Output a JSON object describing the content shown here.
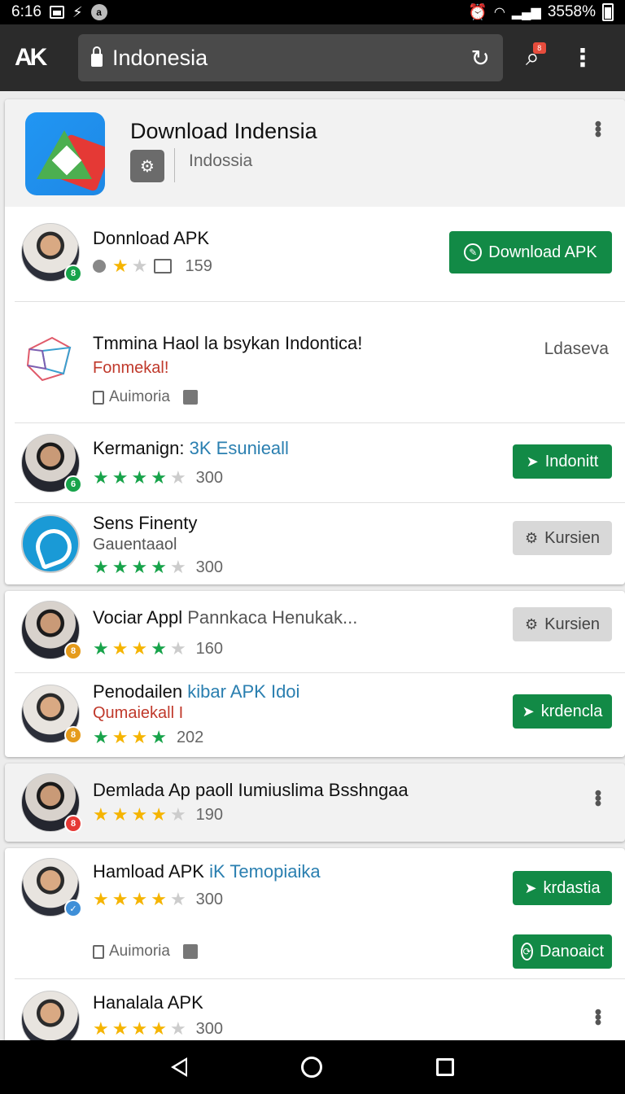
{
  "status_bar": {
    "time": "6:16",
    "battery_text": "3558%"
  },
  "browser": {
    "logo": "AK",
    "url": "Indonesia"
  },
  "header": {
    "title": "Download Indensia",
    "subtitle": "Indossia"
  },
  "colors": {
    "accent_green": "#128a46",
    "link_blue": "#2a7fb0",
    "alert_red": "#c0392b"
  },
  "rows": [
    {
      "name": "Donnload APK",
      "count": "159",
      "button": "Download APK",
      "badge": "8"
    },
    {
      "name": "Tmmina Haol la  bsykan Indontica!",
      "red": "Fonmekal!",
      "tag": "Auimoria",
      "side": "Ldaseva"
    },
    {
      "name": "Kermanign:",
      "accent": "3K Esunieall",
      "count": "300",
      "button": "Indonitt",
      "badge": "6"
    },
    {
      "name": "Sens Finenty",
      "sub": "Gauentaaol",
      "count": "300",
      "button": "Kursien"
    },
    {
      "name": "Vociar Appl",
      "gray": "Pannkaca Henukak...",
      "count": "160",
      "button": "Kursien",
      "badge": "8"
    },
    {
      "name": "Penodailen",
      "accent": "kibar APK Idoi",
      "red": "Qumaiekall I",
      "count": "202",
      "button": "krdencla",
      "badge": "8"
    },
    {
      "name": "Demlada Ap  paoll  Iumiuslima Bsshngaa",
      "count": "190",
      "badge": "8"
    },
    {
      "name": "Hamload APK",
      "accent": "iK Temopiaika",
      "count": "300",
      "button": "krdastia",
      "tag": "Auimoria",
      "button2": "Danoaict",
      "badge": "✓"
    },
    {
      "name": "Hanalala APK",
      "count": "300"
    }
  ]
}
